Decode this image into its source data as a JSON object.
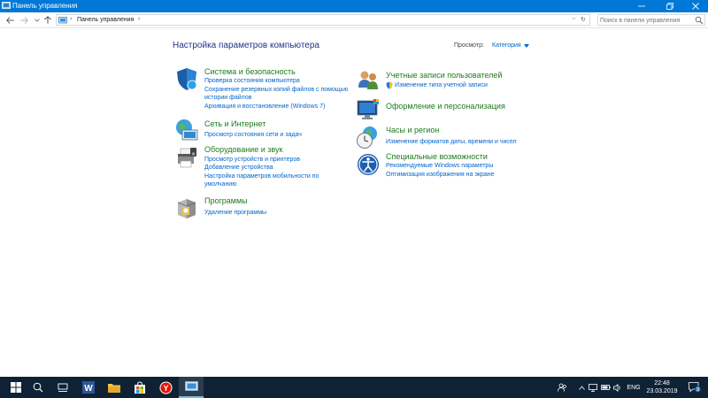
{
  "window": {
    "title": "Панель управления"
  },
  "nav": {
    "breadcrumb": "Панель управления",
    "search_placeholder": "Поиск в панели управления"
  },
  "content": {
    "heading": "Настройка параметров компьютера",
    "view_by_label": "Просмотр:",
    "view_by_value": "Категория"
  },
  "categories": {
    "system": {
      "title": "Система и безопасность",
      "links": [
        "Проверка состояния компьютера",
        "Сохранение резервных копий файлов с помощью",
        "истории файлов",
        "Архивация и восстановление (Windows 7)"
      ]
    },
    "network": {
      "title": "Сеть и Интернет",
      "links": [
        "Просмотр состояния сети и задач"
      ]
    },
    "hardware": {
      "title": "Оборудование и звук",
      "links": [
        "Просмотр устройств и принтеров",
        "Добавление устройства",
        "Настройка параметров мобильности по",
        "умолчанию"
      ]
    },
    "programs": {
      "title": "Программы",
      "links": [
        "Удаление программы"
      ]
    },
    "accounts": {
      "title": "Учетные записи пользователей",
      "links": [
        "Изменение типа учетной записи"
      ]
    },
    "appearance": {
      "title": "Оформление и персонализация",
      "links": []
    },
    "clock": {
      "title": "Часы и регион",
      "links": [
        "Изменение форматов даты, времени и чисел"
      ]
    },
    "access": {
      "title": "Специальные возможности",
      "links": [
        "Рекомендуемые Windows параметры",
        "Оптимизация изображения на экране"
      ]
    }
  },
  "taskbar": {
    "language": "ENG",
    "time": "22:48",
    "date": "23.03.2019",
    "notifications_count": "3"
  },
  "colors": {
    "accent": "#0078d7",
    "heading": "#1e3287",
    "category_title": "#1e7a1e",
    "link": "#0066cc",
    "taskbar": "#0f2235"
  }
}
